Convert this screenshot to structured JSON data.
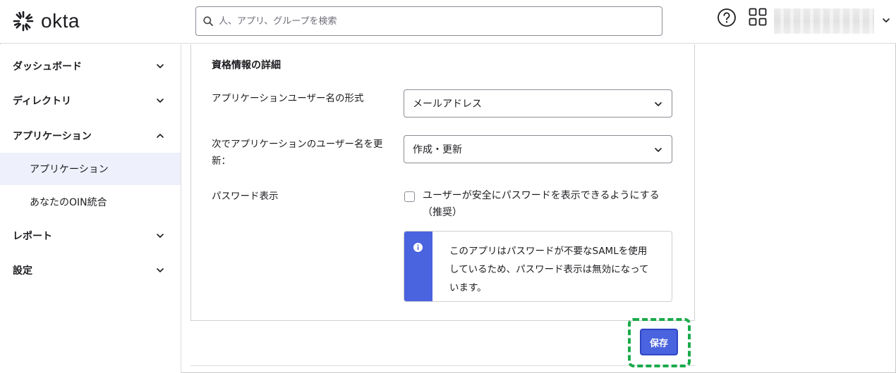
{
  "header": {
    "logo_text": "okta",
    "search_placeholder": "人、アプリ、グループを検索",
    "icons": {
      "logo": "okta-sunburst-icon",
      "search": "search-icon",
      "help": "help-icon",
      "apps": "app-switcher-icon",
      "user_menu": "chevron-down-icon"
    }
  },
  "sidebar": {
    "items": [
      {
        "label": "ダッシュボード",
        "expanded": false
      },
      {
        "label": "ディレクトリ",
        "expanded": false
      },
      {
        "label": "アプリケーション",
        "expanded": true,
        "children": [
          {
            "label": "アプリケーション",
            "active": true
          },
          {
            "label": "あなたのOIN統合",
            "active": false
          }
        ]
      },
      {
        "label": "レポート",
        "expanded": false
      },
      {
        "label": "設定",
        "expanded": false
      }
    ]
  },
  "main": {
    "section_title": "資格情報の詳細",
    "fields": [
      {
        "label": "アプリケーションユーザー名の形式",
        "value": "メールアドレス"
      },
      {
        "label": "次でアプリケーションのユーザー名を更新：",
        "value": "作成・更新"
      }
    ],
    "password_reveal": {
      "label": "パスワード表示",
      "checkbox_label": "ユーザーが安全にパスワードを表示できるようにする（推奨）",
      "checked": false
    },
    "callout_text": "このアプリはパスワードが不要なSAMLを使用しているため、パスワード表示は無効になっています。",
    "save_label": "保存"
  },
  "colors": {
    "accent": "#4a63de",
    "highlight": "#1aaa4a",
    "active_nav_bg": "#eef1fb"
  }
}
